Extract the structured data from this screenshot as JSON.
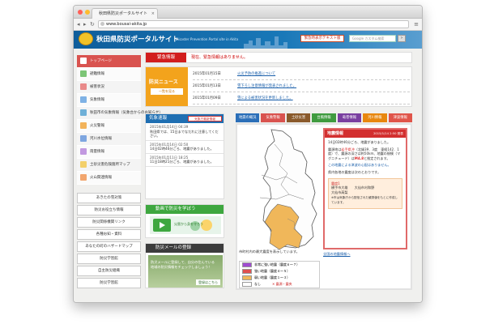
{
  "browser": {
    "tab_title": "秋田県防災ポータルサイト",
    "tab_close": "×",
    "url": "www.bousai-akita.jp",
    "nav_back": "◂",
    "nav_forward": "▸",
    "nav_reload": "↻",
    "menu": "≡"
  },
  "header": {
    "site_title": "秋田県防災ポータルサイト",
    "site_subtitle_en": "Disaster Prevention Portal site in Akita",
    "text_only_button": "緊急時表示テキスト版",
    "search_placeholder": "Google カスタム検索",
    "search_go": "›"
  },
  "sidebar": {
    "items": [
      {
        "label": "トップページ",
        "icon": "home-icon",
        "color": "#d9534f",
        "active": true
      },
      {
        "label": "避難情報",
        "icon": "running-person-icon",
        "color": "#7cc576"
      },
      {
        "label": "被害状況",
        "icon": "house-icon",
        "color": "#e98a8a"
      },
      {
        "label": "気象情報",
        "icon": "cloud-icon",
        "color": "#7fb2e5"
      },
      {
        "label": "秋田市の気象情報（気象台からのお知らせ）",
        "icon": "sun-cloud-icon",
        "color": "#6fb0d8"
      },
      {
        "label": "火災警報",
        "icon": "flame-icon",
        "color": "#f2b35a"
      },
      {
        "label": "河川水位情報",
        "icon": "river-icon",
        "color": "#7ea6e0"
      },
      {
        "label": "雨量情報",
        "icon": "umbrella-icon",
        "color": "#c299e0"
      },
      {
        "label": "土砂災害危険箇所マップ",
        "icon": "landslide-icon",
        "color": "#f3d06a"
      },
      {
        "label": "火山関連情報",
        "icon": "volcano-icon",
        "color": "#f2a66e"
      }
    ],
    "banners": [
      "あきたの雪対策",
      "防災お役立ち情報",
      "防災関係機関リンク",
      "各種お知・資料",
      "あなたの町のハザードマップ",
      "防災学習館",
      "自主防災組織",
      "防災学習館"
    ]
  },
  "emergency": {
    "label": "緊急情報",
    "text": "現在、緊急情報はありません。"
  },
  "news": {
    "label": "防災ニュース",
    "more": "一覧を見る",
    "items": [
      {
        "date": "2015年01月15日",
        "title": "火災予防の推進について"
      },
      {
        "date": "2015年01月13日",
        "title": "雪下ろし注意情報が発表されました。"
      },
      {
        "date": "2015年01月09日",
        "title": "雪による被害状況を更新しました。"
      }
    ]
  },
  "quake_flash": {
    "label": "気象速報",
    "link": "気象庁最新情報",
    "items": [
      {
        "date": "2015年01月14日 04:39",
        "text": "秋田県では、15日までなだれに注意してください。"
      },
      {
        "date": "2015年01月14日 02:50",
        "text": "14日02時46分ごろ、地震がありました。"
      },
      {
        "date": "2015年01月11日 18:25",
        "text": "11日18時21分ごろ、地震がありました。"
      }
    ]
  },
  "video": {
    "label": "動画で防災を学ぼう",
    "caption": "災害から身を守ろう"
  },
  "mail": {
    "label": "防災メールの登録",
    "line1": "防災メールに登録して、自分の住んでいる",
    "line2": "地域の防災情報をチェックしましょう！",
    "button": "登録はこちら"
  },
  "map_tabs": [
    {
      "label": "地震の概況",
      "color": "#2b6fb8"
    },
    {
      "label": "気象警報",
      "color": "#d9534f"
    },
    {
      "label": "土砂災害",
      "color": "#8a5a2b"
    },
    {
      "label": "台風情報",
      "color": "#3f9b3f"
    },
    {
      "label": "竜巻情報",
      "color": "#7a3fa0"
    },
    {
      "label": "河川情報",
      "color": "#e8870e"
    },
    {
      "label": "津波情報",
      "color": "#e0554a"
    }
  ],
  "quake_info": {
    "title": "地震情報",
    "datetime": "2015/1/14 2:50 発表",
    "summary": "14日02時46分ごろ、地震がありました。",
    "epicenter_prefix": "震源地は",
    "epicenter_place": "岩手県沖",
    "epicenter_detail": "（北緯39．3度　東経142．1度）で、震源の深さは約50km、地震の規模（マグニチュード）は",
    "magnitude": "M4.8",
    "magnitude_suffix": "と推定されます。",
    "tsunami": "この地震による津波の心配はありません。",
    "intensity_note": "県内各地の震度は次のとおりです。",
    "box_title": "震度1",
    "box_line1": "横手市大雄　　大仙市刈和野",
    "box_line2": "大仙市高梨",
    "box_note": "※市は気象庁から配信された観測値をもとに作成しています。"
  },
  "legend": {
    "caption": "市町村内の最大震度を表示しています。",
    "link": "全国の地震情報へ",
    "items": [
      {
        "label": "非常に強い地震（震度６～７）",
        "color": "#a04bd1"
      },
      {
        "label": "強い地震（震度４～５）",
        "color": "#e05050"
      },
      {
        "label": "弱い地震（震度１～３）",
        "color": "#f0b75a"
      },
      {
        "label": "なし",
        "color": "#ffffff",
        "extra": "震源・震央"
      }
    ]
  }
}
